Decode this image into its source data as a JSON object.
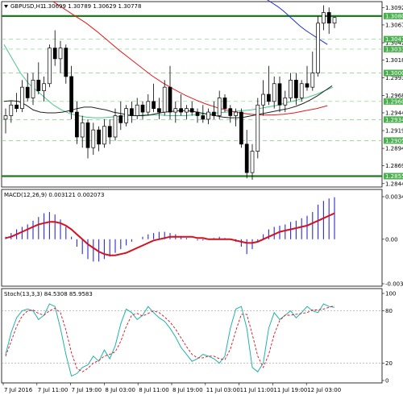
{
  "header": {
    "symbol_line": "GBPUSD,H1",
    "ohlc": "1.30699 1.30789 1.30629 1.30778"
  },
  "macd": {
    "label": "MACD(12,26,9) 0.003121 0.002073",
    "ticks": [
      "0.003441",
      "0.00",
      "-0.003599"
    ]
  },
  "stoch": {
    "label": "Stoch(13,3,3) 84.5308 85.9583",
    "ticks": [
      "100",
      "80",
      "20",
      "0"
    ]
  },
  "price_axis": {
    "ticks": [
      "1.30920",
      "1.30675",
      "1.30425",
      "1.30180",
      "1.29930",
      "1.29685",
      "1.29440",
      "1.29190",
      "1.28940",
      "1.28695",
      "1.28445"
    ],
    "level_labels": [
      "1.30800",
      "1.30475",
      "1.30335",
      "1.30000",
      "1.29600",
      "1.29345",
      "1.29050",
      "1.28550"
    ]
  },
  "time_axis": {
    "labels": [
      "7 Jul 2016",
      "7 Jul 11:00",
      "7 Jul 19:00",
      "8 Jul 03:00",
      "8 Jul 11:00",
      "8 Jul 19:00",
      "11 Jul 03:00",
      "11 Jul 11:00",
      "11 Jul 19:00",
      "12 Jul 03:00"
    ]
  },
  "colors": {
    "bull": "#ffffff",
    "bear": "#000000",
    "ma_red": "#e31a1a",
    "ma_blue": "#1f2fcf",
    "ma_black": "#222222",
    "ma_green": "#46c98b",
    "level_line": "#1f7a1f",
    "grid_dashed": "#7ed07e",
    "level_label_bg": "#4caf50",
    "macd_hist": "#2b2bd6",
    "macd_signal": "#d6101c",
    "stoch_main": "#20b2aa",
    "stoch_signal": "#d6101c"
  },
  "chart_data": {
    "type": "candlestick",
    "title": "GBPUSD,H1",
    "ylim": [
      1.2842,
      1.3098
    ],
    "key_levels": [
      1.308,
      1.2855
    ],
    "candles": [
      {
        "o": 1.2935,
        "h": 1.295,
        "l": 1.2915,
        "c": 1.294
      },
      {
        "o": 1.294,
        "h": 1.296,
        "l": 1.293,
        "c": 1.2955
      },
      {
        "o": 1.2955,
        "h": 1.2972,
        "l": 1.2945,
        "c": 1.295
      },
      {
        "o": 1.295,
        "h": 1.299,
        "l": 1.2945,
        "c": 1.298
      },
      {
        "o": 1.298,
        "h": 1.3,
        "l": 1.296,
        "c": 1.2965
      },
      {
        "o": 1.2965,
        "h": 1.3,
        "l": 1.2955,
        "c": 1.299
      },
      {
        "o": 1.299,
        "h": 1.3015,
        "l": 1.297,
        "c": 1.2975
      },
      {
        "o": 1.2975,
        "h": 1.2995,
        "l": 1.296,
        "c": 1.2985
      },
      {
        "o": 1.2985,
        "h": 1.304,
        "l": 1.298,
        "c": 1.3035
      },
      {
        "o": 1.3035,
        "h": 1.306,
        "l": 1.301,
        "c": 1.302
      },
      {
        "o": 1.302,
        "h": 1.3045,
        "l": 1.3,
        "c": 1.3035
      },
      {
        "o": 1.3035,
        "h": 1.304,
        "l": 1.2985,
        "c": 1.2995
      },
      {
        "o": 1.2995,
        "h": 1.301,
        "l": 1.2935,
        "c": 1.2945
      },
      {
        "o": 1.2945,
        "h": 1.296,
        "l": 1.29,
        "c": 1.291
      },
      {
        "o": 1.291,
        "h": 1.294,
        "l": 1.2895,
        "c": 1.293
      },
      {
        "o": 1.293,
        "h": 1.2935,
        "l": 1.288,
        "c": 1.2895
      },
      {
        "o": 1.2895,
        "h": 1.293,
        "l": 1.2885,
        "c": 1.292
      },
      {
        "o": 1.292,
        "h": 1.2925,
        "l": 1.289,
        "c": 1.29
      },
      {
        "o": 1.29,
        "h": 1.2935,
        "l": 1.2895,
        "c": 1.2925
      },
      {
        "o": 1.2925,
        "h": 1.2935,
        "l": 1.29,
        "c": 1.291
      },
      {
        "o": 1.291,
        "h": 1.295,
        "l": 1.2905,
        "c": 1.294
      },
      {
        "o": 1.294,
        "h": 1.296,
        "l": 1.292,
        "c": 1.293
      },
      {
        "o": 1.293,
        "h": 1.2955,
        "l": 1.2925,
        "c": 1.295
      },
      {
        "o": 1.295,
        "h": 1.296,
        "l": 1.293,
        "c": 1.294
      },
      {
        "o": 1.294,
        "h": 1.2965,
        "l": 1.2935,
        "c": 1.2955
      },
      {
        "o": 1.2955,
        "h": 1.296,
        "l": 1.2935,
        "c": 1.2945
      },
      {
        "o": 1.2945,
        "h": 1.297,
        "l": 1.294,
        "c": 1.296
      },
      {
        "o": 1.296,
        "h": 1.2985,
        "l": 1.2945,
        "c": 1.295
      },
      {
        "o": 1.295,
        "h": 1.2965,
        "l": 1.2935,
        "c": 1.2945
      },
      {
        "o": 1.2945,
        "h": 1.299,
        "l": 1.294,
        "c": 1.298
      },
      {
        "o": 1.298,
        "h": 1.301,
        "l": 1.2935,
        "c": 1.2945
      },
      {
        "o": 1.2945,
        "h": 1.296,
        "l": 1.293,
        "c": 1.295
      },
      {
        "o": 1.295,
        "h": 1.297,
        "l": 1.294,
        "c": 1.2945
      },
      {
        "o": 1.2945,
        "h": 1.2955,
        "l": 1.2935,
        "c": 1.295
      },
      {
        "o": 1.295,
        "h": 1.296,
        "l": 1.294,
        "c": 1.2945
      },
      {
        "o": 1.2945,
        "h": 1.295,
        "l": 1.293,
        "c": 1.294
      },
      {
        "o": 1.294,
        "h": 1.2955,
        "l": 1.293,
        "c": 1.2935
      },
      {
        "o": 1.2935,
        "h": 1.295,
        "l": 1.2928,
        "c": 1.2945
      },
      {
        "o": 1.2945,
        "h": 1.296,
        "l": 1.2935,
        "c": 1.294
      },
      {
        "o": 1.294,
        "h": 1.2975,
        "l": 1.2935,
        "c": 1.2965
      },
      {
        "o": 1.2965,
        "h": 1.297,
        "l": 1.2945,
        "c": 1.295
      },
      {
        "o": 1.295,
        "h": 1.2955,
        "l": 1.293,
        "c": 1.294
      },
      {
        "o": 1.294,
        "h": 1.295,
        "l": 1.2925,
        "c": 1.2945
      },
      {
        "o": 1.2945,
        "h": 1.295,
        "l": 1.2895,
        "c": 1.29
      },
      {
        "o": 1.29,
        "h": 1.292,
        "l": 1.2852,
        "c": 1.286
      },
      {
        "o": 1.286,
        "h": 1.29,
        "l": 1.285,
        "c": 1.289
      },
      {
        "o": 1.289,
        "h": 1.2965,
        "l": 1.288,
        "c": 1.2955
      },
      {
        "o": 1.2955,
        "h": 1.299,
        "l": 1.294,
        "c": 1.297
      },
      {
        "o": 1.297,
        "h": 1.301,
        "l": 1.2955,
        "c": 1.296
      },
      {
        "o": 1.296,
        "h": 1.2995,
        "l": 1.295,
        "c": 1.2985
      },
      {
        "o": 1.2985,
        "h": 1.2995,
        "l": 1.2945,
        "c": 1.2955
      },
      {
        "o": 1.2955,
        "h": 1.2975,
        "l": 1.2945,
        "c": 1.2965
      },
      {
        "o": 1.2965,
        "h": 1.3,
        "l": 1.296,
        "c": 1.299
      },
      {
        "o": 1.299,
        "h": 1.3,
        "l": 1.2955,
        "c": 1.2965
      },
      {
        "o": 1.2965,
        "h": 1.299,
        "l": 1.296,
        "c": 1.2985
      },
      {
        "o": 1.2985,
        "h": 1.301,
        "l": 1.2975,
        "c": 1.298
      },
      {
        "o": 1.298,
        "h": 1.303,
        "l": 1.2975,
        "c": 1.3
      },
      {
        "o": 1.3,
        "h": 1.308,
        "l": 1.2995,
        "c": 1.307
      },
      {
        "o": 1.307,
        "h": 1.3095,
        "l": 1.306,
        "c": 1.3085
      },
      {
        "o": 1.3085,
        "h": 1.3092,
        "l": 1.3055,
        "c": 1.307
      },
      {
        "o": 1.307,
        "h": 1.3079,
        "l": 1.3063,
        "c": 1.3078
      }
    ],
    "moving_averages": [
      {
        "color": "ma_green",
        "values": [
          1.304,
          1.302,
          1.3,
          1.2985,
          1.2975,
          1.2965,
          1.2955,
          1.2948,
          1.2943,
          1.294,
          1.2938,
          1.2937,
          1.2937,
          1.2938,
          1.2939,
          1.294,
          1.294,
          1.2941,
          1.2941,
          1.2941,
          1.294,
          1.294,
          1.294,
          1.2941,
          1.2942,
          1.2943,
          1.2944,
          1.2945,
          1.2946,
          1.2947,
          1.2948,
          1.295,
          1.2952,
          1.2954,
          1.2957,
          1.296,
          1.2963,
          1.2966,
          1.297,
          1.2975,
          1.298
        ]
      },
      {
        "color": "ma_black",
        "values": [
          1.296,
          1.2961,
          1.296,
          1.2955,
          1.2948,
          1.2945,
          1.2944,
          1.2944,
          1.2945,
          1.2947,
          1.295,
          1.2952,
          1.2952,
          1.295,
          1.2948,
          1.2945,
          1.2943,
          1.2941,
          1.294,
          1.294,
          1.2941,
          1.2943,
          1.2945,
          1.2946,
          1.2947,
          1.2947,
          1.2946,
          1.2944,
          1.2942,
          1.294,
          1.2938,
          1.2937,
          1.2937,
          1.2938,
          1.294,
          1.2942,
          1.2944,
          1.2946,
          1.2948,
          1.295,
          1.2953,
          1.2957,
          1.2962,
          1.2968,
          1.2975,
          1.2982
        ]
      },
      {
        "color": "ma_red",
        "values": [
          1.31,
          1.309,
          1.308,
          1.307,
          1.3058,
          1.3045,
          1.3032,
          1.302,
          1.3008,
          1.2996,
          1.2986,
          1.2977,
          1.2969,
          1.2962,
          1.2956,
          1.2951,
          1.2947,
          1.2944,
          1.2942,
          1.2941,
          1.2941,
          1.2942,
          1.2944,
          1.2947,
          1.295,
          1.2954
        ]
      },
      {
        "color": "ma_blue",
        "values": [
          1.3115,
          1.3113,
          1.311,
          1.3107,
          1.3103,
          1.3098,
          1.3093,
          1.3087,
          1.308,
          1.3073,
          1.3066,
          1.306,
          1.3055,
          1.305,
          1.3045,
          1.304
        ]
      }
    ],
    "macd": {
      "ylim": [
        -0.003599,
        0.003441
      ],
      "histogram": [
        0.0002,
        0.0005,
        0.0008,
        0.001,
        0.0012,
        0.0015,
        0.0018,
        0.0021,
        0.0022,
        0.002,
        0.0016,
        0.001,
        0.0002,
        -0.0006,
        -0.0012,
        -0.0016,
        -0.0018,
        -0.0018,
        -0.0016,
        -0.0014,
        -0.0011,
        -0.0008,
        -0.0005,
        -0.0002,
        0.0,
        0.0002,
        0.0004,
        0.0005,
        0.0006,
        0.0006,
        0.0005,
        0.0004,
        0.0002,
        0.0001,
        0.0,
        -0.0001,
        -0.0001,
        0.0,
        0.0001,
        0.0002,
        0.0001,
        0.0,
        -0.0002,
        -0.0006,
        -0.0012,
        -0.0008,
        -0.0002,
        0.0004,
        0.0008,
        0.001,
        0.0011,
        0.0012,
        0.0014,
        0.0015,
        0.0017,
        0.0019,
        0.0022,
        0.0028,
        0.0031,
        0.0033,
        0.0034
      ],
      "signal": [
        0.0001,
        0.0002,
        0.0004,
        0.0006,
        0.0008,
        0.001,
        0.0012,
        0.0013,
        0.0014,
        0.0014,
        0.0013,
        0.0011,
        0.0008,
        0.0004,
        0.0,
        -0.0004,
        -0.0007,
        -0.001,
        -0.0012,
        -0.0013,
        -0.0013,
        -0.0012,
        -0.0011,
        -0.0009,
        -0.0007,
        -0.0005,
        -0.0003,
        -0.0001,
        0.0,
        0.0001,
        0.0002,
        0.0002,
        0.0002,
        0.0002,
        0.0002,
        0.0001,
        0.0001,
        0.0,
        0.0,
        0.0,
        0.0,
        0.0,
        -0.0001,
        -0.0002,
        -0.0003,
        -0.0003,
        -0.0002,
        0.0,
        0.0002,
        0.0004,
        0.0006,
        0.0007,
        0.0008,
        0.0009,
        0.001,
        0.0011,
        0.0013,
        0.0015,
        0.0017,
        0.0019,
        0.0021
      ]
    },
    "stochastic": {
      "ylim": [
        0,
        100
      ],
      "main": [
        30,
        55,
        72,
        80,
        82,
        80,
        70,
        75,
        88,
        85,
        60,
        30,
        5,
        8,
        15,
        18,
        28,
        22,
        35,
        25,
        40,
        65,
        82,
        78,
        70,
        75,
        85,
        78,
        72,
        68,
        60,
        50,
        38,
        30,
        22,
        25,
        30,
        28,
        25,
        20,
        28,
        60,
        82,
        85,
        60,
        15,
        10,
        20,
        60,
        78,
        70,
        75,
        80,
        72,
        78,
        85,
        80,
        78,
        88,
        85,
        84
      ],
      "signal": [
        28,
        45,
        62,
        74,
        80,
        81,
        77,
        75,
        80,
        83,
        78,
        58,
        32,
        14,
        10,
        14,
        20,
        23,
        28,
        30,
        33,
        45,
        62,
        75,
        77,
        74,
        77,
        80,
        78,
        73,
        67,
        59,
        49,
        39,
        30,
        26,
        26,
        28,
        28,
        25,
        24,
        36,
        57,
        76,
        76,
        53,
        28,
        15,
        30,
        53,
        69,
        75,
        75,
        76,
        77,
        78,
        81,
        81,
        82,
        84,
        86
      ]
    }
  }
}
